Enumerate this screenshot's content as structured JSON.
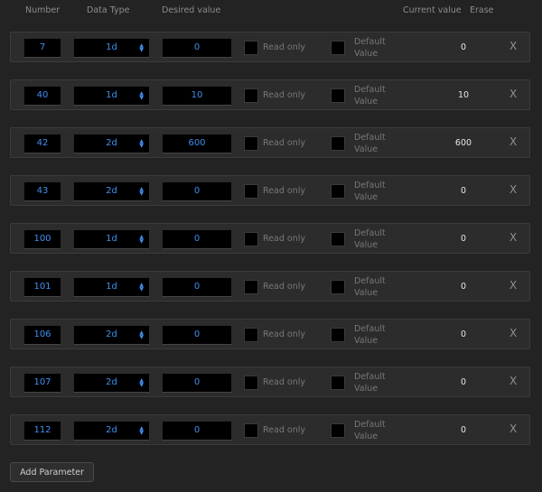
{
  "header": {
    "number": "Number",
    "data_type": "Data Type",
    "desired_value": "Desired value",
    "current_value": "Current value",
    "erase": "Erase"
  },
  "labels": {
    "read_only": "Read only",
    "default_line1": "Default",
    "default_line2": "Value",
    "erase_glyph": "X",
    "chevron_icon": "up-down-chevron-icon"
  },
  "rows": [
    {
      "number": "7",
      "type": "1d",
      "desired": "0",
      "current": "0"
    },
    {
      "number": "40",
      "type": "1d",
      "desired": "10",
      "current": "10"
    },
    {
      "number": "42",
      "type": "2d",
      "desired": "600",
      "current": "600"
    },
    {
      "number": "43",
      "type": "2d",
      "desired": "0",
      "current": "0"
    },
    {
      "number": "100",
      "type": "1d",
      "desired": "0",
      "current": "0"
    },
    {
      "number": "101",
      "type": "1d",
      "desired": "0",
      "current": "0"
    },
    {
      "number": "106",
      "type": "2d",
      "desired": "0",
      "current": "0"
    },
    {
      "number": "107",
      "type": "2d",
      "desired": "0",
      "current": "0"
    },
    {
      "number": "112",
      "type": "2d",
      "desired": "0",
      "current": "0"
    }
  ],
  "add_button": "Add Parameter",
  "colors": {
    "background": "#232323",
    "row_bg": "#2c2c2c",
    "field_text": "#3f8ff0",
    "current_text": "#e6e6e6"
  }
}
